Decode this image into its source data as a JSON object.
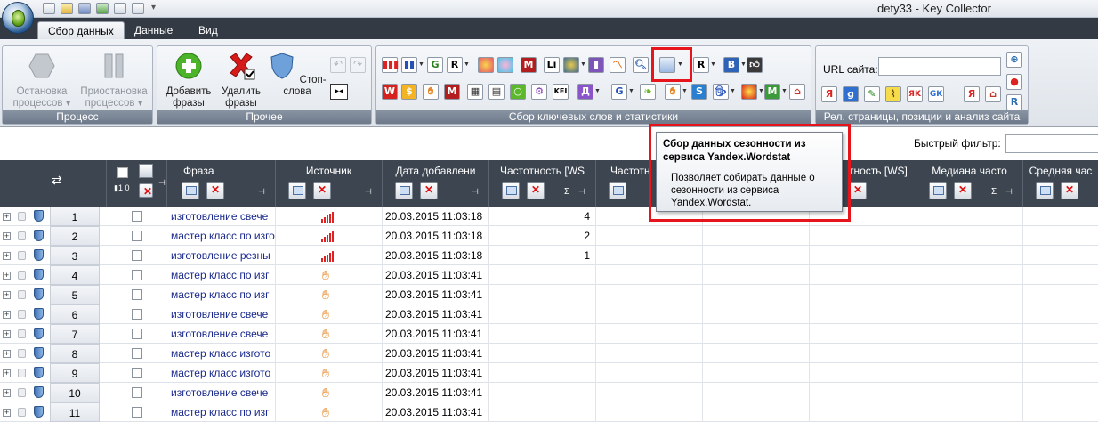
{
  "window": {
    "title": "dety33 - Key Collector"
  },
  "ribbon_tabs": [
    "Сбор данных",
    "Данные",
    "Вид"
  ],
  "groups": {
    "process": {
      "label": "Процесс",
      "stop_label": "Остановка процессов",
      "pause_label": "Приостановка процессов"
    },
    "other": {
      "label": "Прочее",
      "add_label": "Добавить фразы",
      "delete_label": "Удалить фразы",
      "stopwords_label": "Стоп-слова"
    },
    "collect": {
      "label": "Сбор ключевых слов и статистики"
    },
    "relevance": {
      "label": "Рел. страницы, позиции и анализ сайта",
      "url_label": "URL сайта:",
      "url_value": ""
    }
  },
  "quick_filter": {
    "label": "Быстрый фильтр:",
    "value": ""
  },
  "grid": {
    "columns": [
      "Фраза",
      "Источник",
      "Дата добавлени",
      "Частотность [WS",
      "Частотн",
      "тность [WS]",
      "Медиана часто",
      "Средняя час"
    ],
    "rows": [
      {
        "num": "1",
        "phrase": "изготовление свече",
        "source": "bars",
        "date": "20.03.2015 11:03:18",
        "freq": "4"
      },
      {
        "num": "2",
        "phrase": "мастер класс по изго",
        "source": "bars",
        "date": "20.03.2015 11:03:18",
        "freq": "2"
      },
      {
        "num": "3",
        "phrase": "изготовление резны",
        "source": "bars",
        "date": "20.03.2015 11:03:18",
        "freq": "1"
      },
      {
        "num": "4",
        "phrase": "мастер класс по изг",
        "source": "hand",
        "date": "20.03.2015 11:03:41",
        "freq": ""
      },
      {
        "num": "5",
        "phrase": "мастер класс по изг",
        "source": "hand",
        "date": "20.03.2015 11:03:41",
        "freq": ""
      },
      {
        "num": "6",
        "phrase": "изготовление свече",
        "source": "hand",
        "date": "20.03.2015 11:03:41",
        "freq": ""
      },
      {
        "num": "7",
        "phrase": "изготовление свече",
        "source": "hand",
        "date": "20.03.2015 11:03:41",
        "freq": ""
      },
      {
        "num": "8",
        "phrase": "мастер класс изгото",
        "source": "hand",
        "date": "20.03.2015 11:03:41",
        "freq": ""
      },
      {
        "num": "9",
        "phrase": "мастер класс изгото",
        "source": "hand",
        "date": "20.03.2015 11:03:41",
        "freq": ""
      },
      {
        "num": "10",
        "phrase": "изготовление свече",
        "source": "hand",
        "date": "20.03.2015 11:03:41",
        "freq": ""
      },
      {
        "num": "11",
        "phrase": "мастер класс по изг",
        "source": "hand",
        "date": "20.03.2015 11:03:41",
        "freq": ""
      }
    ]
  },
  "tooltip": {
    "title": "Сбор данных сезонности из сервиса Yandex.Wordstat",
    "body": "Позволяет собирать данные о сезонности из сервиса Yandex.Wordstat."
  },
  "colors": {
    "highlight": "#e8141c",
    "header_bg": "#3d4550",
    "phrase_text": "#1a2a8c"
  }
}
